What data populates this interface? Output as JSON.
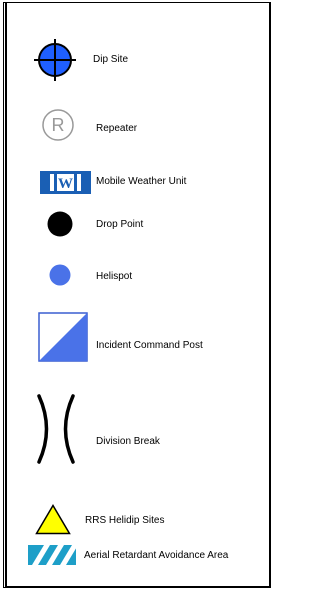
{
  "legend": {
    "items": [
      {
        "id": "dip-site",
        "label": "Dip Site",
        "icon": "crosshair-circle-icon",
        "color": "#1f5fff"
      },
      {
        "id": "repeater",
        "label": "Repeater",
        "icon": "registered-circle-icon",
        "color": "#999999"
      },
      {
        "id": "mobile-weather-unit",
        "label": "Mobile Weather Unit",
        "icon": "weather-unit-box-icon",
        "color": "#1a5fb4"
      },
      {
        "id": "drop-point",
        "label": "Drop Point",
        "icon": "black-dot-icon",
        "color": "#000000"
      },
      {
        "id": "helispot",
        "label": "Helispot",
        "icon": "blue-dot-icon",
        "color": "#4a72e8"
      },
      {
        "id": "incident-command-post",
        "label": "Incident Command Post",
        "icon": "icp-square-icon",
        "color": "#4a72e8"
      },
      {
        "id": "division-break",
        "label": "Division Break",
        "icon": "parentheses-icon",
        "color": "#000000"
      },
      {
        "id": "rrs-helidip-sites",
        "label": "RRS Helidip Sites",
        "icon": "yellow-triangle-icon",
        "color": "#ffff00"
      },
      {
        "id": "aerial-retardant-avoidance-area",
        "label": "Aerial Retardant Avoidance Area",
        "icon": "hatched-bar-icon",
        "color": "#1e9fc8"
      }
    ]
  },
  "symbols": {
    "repeater_glyph": "R",
    "weather_unit_glyph": "W"
  }
}
